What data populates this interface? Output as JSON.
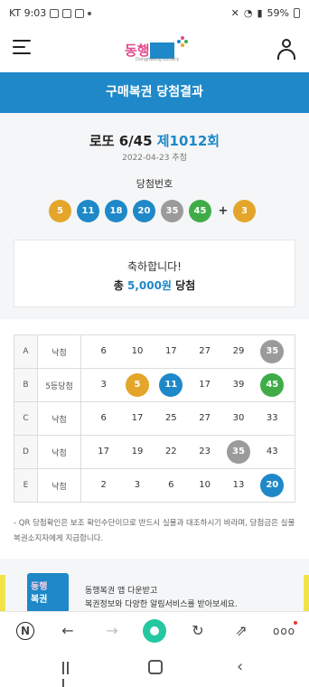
{
  "status_bar": {
    "carrier_time": "KT 9:03",
    "battery": "59%"
  },
  "header": {
    "logo_text_pink": "동행",
    "logo_text_blue": "복권",
    "logo_sub": "Donghaeng Lottery"
  },
  "title_bar": "구매복권 당첨결과",
  "draw": {
    "game": "로또 6/45",
    "round": "제1012회",
    "date": "2022-04-23 추첨",
    "winning_label": "당첨번호",
    "numbers": [
      "5",
      "11",
      "18",
      "20",
      "35",
      "45"
    ],
    "plus": "+",
    "bonus": "3"
  },
  "congrats": {
    "line1": "축하합니다!",
    "line2_prefix": "총 ",
    "amount": "5,000원",
    "line2_suffix": " 당첨"
  },
  "ticket": {
    "rows": [
      {
        "label": "A",
        "result": "낙첨",
        "numbers": [
          "6",
          "10",
          "17",
          "27",
          "29",
          "35"
        ]
      },
      {
        "label": "B",
        "result": "5등당첨",
        "numbers": [
          "3",
          "5",
          "11",
          "17",
          "39",
          "45"
        ]
      },
      {
        "label": "C",
        "result": "낙첨",
        "numbers": [
          "6",
          "17",
          "25",
          "27",
          "30",
          "33"
        ]
      },
      {
        "label": "D",
        "result": "낙첨",
        "numbers": [
          "17",
          "19",
          "22",
          "23",
          "35",
          "43"
        ]
      },
      {
        "label": "E",
        "result": "낙첨",
        "numbers": [
          "2",
          "3",
          "6",
          "10",
          "13",
          "20"
        ]
      }
    ]
  },
  "notice": "- QR 당첨확인은 보조 확인수단이므로 반드시 실물과 대조하시기 바라며, 당첨금은 실물 복권소지자에게 지급합니다.",
  "banner": {
    "logo_line1": "동행",
    "logo_line2": "복권",
    "line1": "동행복권 앱 다운받고",
    "line2": "복권정보와 다양한 알림서비스를 받아보세요."
  },
  "toolbar": {
    "n_label": "N",
    "back": "←",
    "forward": "→",
    "reload": "↻",
    "share": "⇗",
    "more": "ooo"
  },
  "navbar": {
    "back": "‹"
  },
  "colors": {
    "brand_blue": "#1e88c8",
    "ball_yellow": "#e3a52a",
    "ball_blue": "#1e88c8",
    "ball_gray": "#9b9b9b",
    "ball_green": "#3fac48",
    "home_green": "#24c7a0"
  }
}
